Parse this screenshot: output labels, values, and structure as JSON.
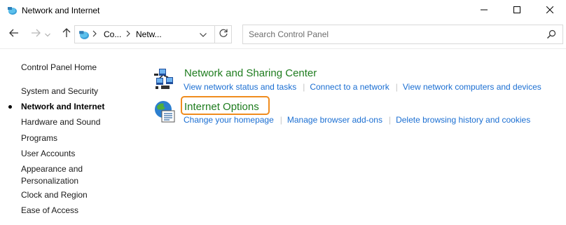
{
  "window": {
    "title": "Network and Internet"
  },
  "navigation": {
    "breadcrumb_1": "Co...",
    "breadcrumb_2": "Netw..."
  },
  "search": {
    "placeholder": "Search Control Panel",
    "value": ""
  },
  "sidebar": {
    "home": "Control Panel Home",
    "items": [
      {
        "label": "System and Security",
        "active": false
      },
      {
        "label": "Network and Internet",
        "active": true
      },
      {
        "label": "Hardware and Sound",
        "active": false
      },
      {
        "label": "Programs",
        "active": false
      },
      {
        "label": "User Accounts",
        "active": false
      },
      {
        "label": "Appearance and",
        "active": false
      },
      {
        "label": "Personalization",
        "active": false
      },
      {
        "label": "Clock and Region",
        "active": false
      },
      {
        "label": "Ease of Access",
        "active": false
      }
    ]
  },
  "categories": [
    {
      "title": "Network and Sharing Center",
      "icon": "network-sharing-icon",
      "links": [
        "View network status and tasks",
        "Connect to a network",
        "View network computers and devices"
      ]
    },
    {
      "title": "Internet Options",
      "icon": "internet-options-icon",
      "highlighted": true,
      "links": [
        "Change your homepage",
        "Manage browser add-ons",
        "Delete browsing history and cookies"
      ]
    }
  ],
  "colors": {
    "category_title": "#1e7c1e",
    "link": "#1a6ed2",
    "highlight": "#f08c1e"
  }
}
